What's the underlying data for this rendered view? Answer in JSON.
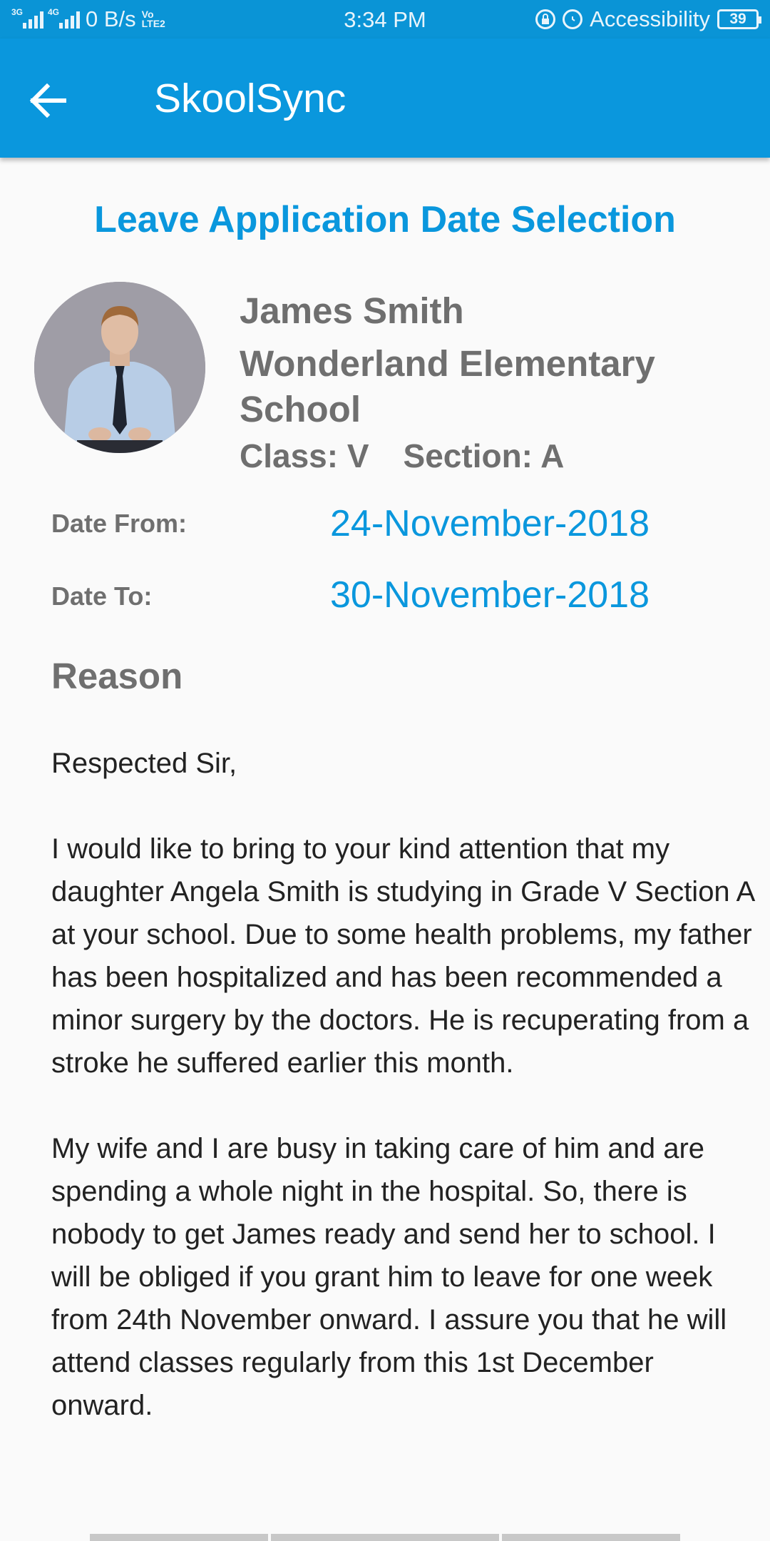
{
  "status_bar": {
    "net1": "3G",
    "net2": "4G",
    "data_rate": "0 B/s",
    "volte": "Vo LTE2",
    "time": "3:34 PM",
    "accessibility": "Accessibility",
    "battery": "39"
  },
  "app_bar": {
    "title": "SkoolSync",
    "back_icon": "arrow-left-icon"
  },
  "screen_title": "Leave Application Date Selection",
  "student": {
    "name": "James Smith",
    "school": "Wonderland Elementary School",
    "class_text": "Class: V",
    "section_text": "Section: A"
  },
  "dates": {
    "from_label": "Date From:",
    "from_value": "24-November-2018",
    "to_label": "Date To:",
    "to_value": "30-November-2018"
  },
  "reason": {
    "label": "Reason",
    "greeting": "Respected Sir,",
    "paragraph1": "I would like to bring to your kind attention that my daughter Angela Smith is studying in Grade V Section A at your school. Due to some health problems, my father has been hospitalized and has been recommended a minor surgery by the doctors. He is recuperating from a stroke he suffered earlier this month.",
    "paragraph2": "My wife and I are busy in taking care of him and are spending a whole night in the hospital. So, there is nobody to get James ready and send her to school. I will be obliged if you grant him to leave for one week from 24th November onward. I assure you that he will attend classes regularly from this 1st December onward."
  },
  "colors": {
    "primary": "#0a97dd",
    "status_bar": "#0a94d6",
    "label_gray": "#6f6f6f",
    "background": "#fafafa"
  }
}
